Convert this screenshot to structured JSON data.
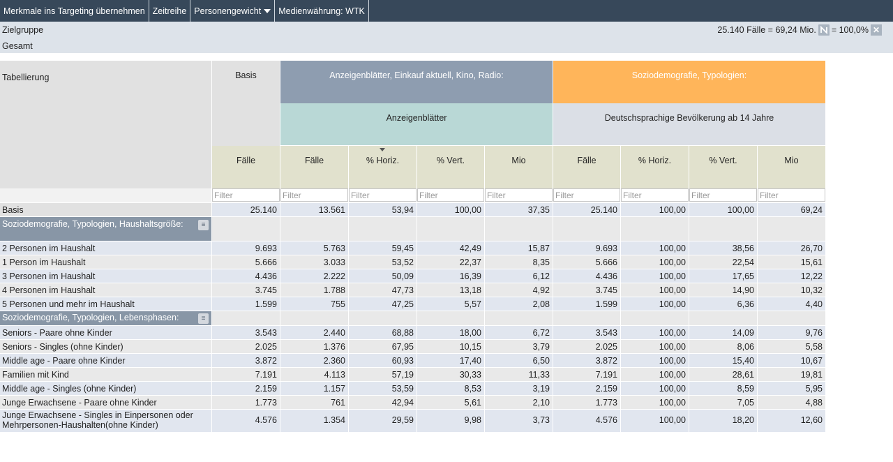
{
  "toolbar": {
    "items": [
      "Merkmale ins Targeting übernehmen",
      "Zeitreihe",
      "Personengewicht",
      "Medienwährung: WTK"
    ]
  },
  "zielgruppe": {
    "label": "Zielgruppe",
    "value": "Gesamt",
    "summary": "25.140 Fälle = 69,24 Mio.",
    "percent": "= 100,0%"
  },
  "table": {
    "corner_label": "Tabellierung",
    "basis_header": "Basis",
    "group1_title": "Anzeigenblätter, Einkauf aktuell, Kino, Radio:",
    "group1_sub": "Anzeigenblätter",
    "group2_title": "Soziodemografie, Typologien:",
    "group2_sub": "Deutschsprachige Bevölkerung ab 14 Jahre",
    "columns": [
      "Fälle",
      "Fälle",
      "% Horiz.",
      "% Vert.",
      "Mio",
      "Fälle",
      "% Horiz.",
      "% Vert.",
      "Mio"
    ],
    "filter_placeholder": "Filter",
    "basis_row": {
      "label": "Basis",
      "values": [
        "25.140",
        "13.561",
        "53,94",
        "100,00",
        "37,35",
        "25.140",
        "100,00",
        "100,00",
        "69,24"
      ]
    },
    "group_a": {
      "title": "Soziodemografie, Typologien, Haushaltsgröße:",
      "rows": [
        {
          "label": "2 Personen im Haushalt",
          "values": [
            "9.693",
            "5.763",
            "59,45",
            "42,49",
            "15,87",
            "9.693",
            "100,00",
            "38,56",
            "26,70"
          ]
        },
        {
          "label": "1 Person im Haushalt",
          "values": [
            "5.666",
            "3.033",
            "53,52",
            "22,37",
            "8,35",
            "5.666",
            "100,00",
            "22,54",
            "15,61"
          ]
        },
        {
          "label": "3 Personen im Haushalt",
          "values": [
            "4.436",
            "2.222",
            "50,09",
            "16,39",
            "6,12",
            "4.436",
            "100,00",
            "17,65",
            "12,22"
          ]
        },
        {
          "label": "4 Personen im Haushalt",
          "values": [
            "3.745",
            "1.788",
            "47,73",
            "13,18",
            "4,92",
            "3.745",
            "100,00",
            "14,90",
            "10,32"
          ]
        },
        {
          "label": "5 Personen  und mehr im Haushalt",
          "values": [
            "1.599",
            "755",
            "47,25",
            "5,57",
            "2,08",
            "1.599",
            "100,00",
            "6,36",
            "4,40"
          ]
        }
      ]
    },
    "group_b": {
      "title": "Soziodemografie, Typologien, Lebensphasen:",
      "rows": [
        {
          "label": "Seniors - Paare ohne Kinder",
          "values": [
            "3.543",
            "2.440",
            "68,88",
            "18,00",
            "6,72",
            "3.543",
            "100,00",
            "14,09",
            "9,76"
          ]
        },
        {
          "label": "Seniors - Singles (ohne Kinder)",
          "values": [
            "2.025",
            "1.376",
            "67,95",
            "10,15",
            "3,79",
            "2.025",
            "100,00",
            "8,06",
            "5,58"
          ]
        },
        {
          "label": "Middle age - Paare ohne Kinder",
          "values": [
            "3.872",
            "2.360",
            "60,93",
            "17,40",
            "6,50",
            "3.872",
            "100,00",
            "15,40",
            "10,67"
          ]
        },
        {
          "label": "Familien mit Kind",
          "values": [
            "7.191",
            "4.113",
            "57,19",
            "30,33",
            "11,33",
            "7.191",
            "100,00",
            "28,61",
            "19,81"
          ]
        },
        {
          "label": "Middle age - Singles (ohne Kinder)",
          "values": [
            "2.159",
            "1.157",
            "53,59",
            "8,53",
            "3,19",
            "2.159",
            "100,00",
            "8,59",
            "5,95"
          ]
        },
        {
          "label": "Junge Erwachsene - Paare ohne Kinder",
          "values": [
            "1.773",
            "761",
            "42,94",
            "5,61",
            "2,10",
            "1.773",
            "100,00",
            "7,05",
            "4,88"
          ]
        },
        {
          "label": "Junge Erwachsene - Singles in Einpersonen oder Mehrpersonen-Haushalten(ohne Kinder)",
          "values": [
            "4.576",
            "1.354",
            "29,59",
            "9,98",
            "3,73",
            "4.576",
            "100,00",
            "18,20",
            "12,60"
          ]
        }
      ]
    }
  },
  "colors": {
    "toolbar_bg": "#37485a",
    "group1_bg": "#8e9db0",
    "group2_bg": "#ffb55a",
    "group1_sub_bg": "#b9d8d6",
    "group2_sub_bg": "#dbdfe6",
    "column_header_bg": "#e1e1cd",
    "row_grey": "#e9e9e9",
    "row_blue": "#e1e6ef",
    "group_row_bg": "#8896a6"
  }
}
